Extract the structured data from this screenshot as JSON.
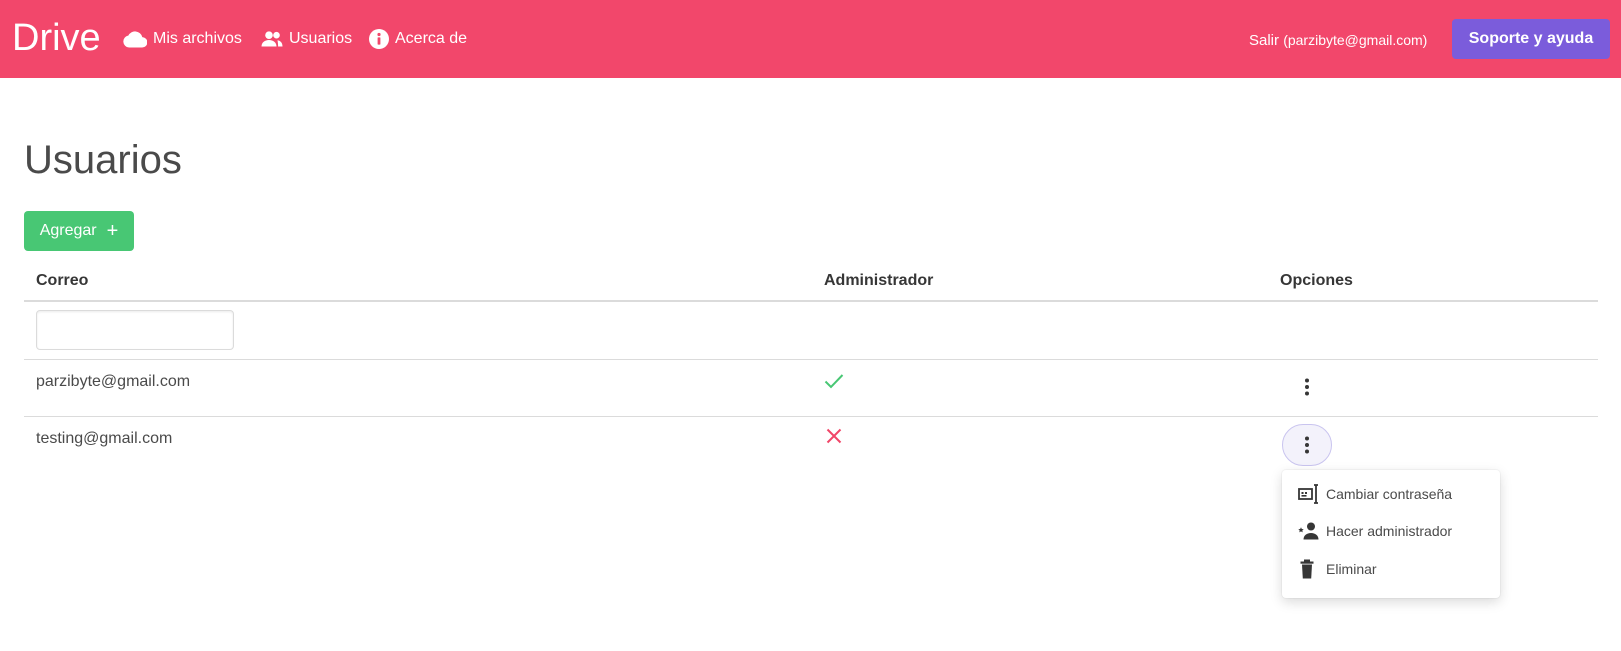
{
  "nav": {
    "brand": "Drive",
    "items": [
      {
        "label": "Mis archivos",
        "icon": "cloud-icon"
      },
      {
        "label": "Usuarios",
        "icon": "users-icon"
      },
      {
        "label": "Acerca de",
        "icon": "info-icon"
      }
    ],
    "logout_label": "Salir",
    "logout_email": "(parzibyte@gmail.com)",
    "support_label": "Soporte y ayuda"
  },
  "page": {
    "title": "Usuarios",
    "add_label": "Agregar",
    "add_icon": "plus-icon"
  },
  "table": {
    "headers": [
      "Correo",
      "Administrador",
      "Opciones"
    ],
    "search_placeholder": "",
    "search_value": "",
    "rows": [
      {
        "email": "parzibyte@gmail.com",
        "admin": true,
        "admin_icon": "check-icon"
      },
      {
        "email": "testing@gmail.com",
        "admin": false,
        "admin_icon": "x-icon"
      }
    ]
  },
  "menu": {
    "items": [
      {
        "label": "Cambiar contraseña",
        "icon": "password-icon"
      },
      {
        "label": "Hacer administrador",
        "icon": "make-admin-icon"
      },
      {
        "label": "Eliminar",
        "icon": "trash-icon"
      }
    ]
  },
  "colors": {
    "navbar": "#f2476b",
    "support": "#7b5cdb",
    "add": "#48c774",
    "check": "#48c774",
    "cross": "#f14668"
  }
}
